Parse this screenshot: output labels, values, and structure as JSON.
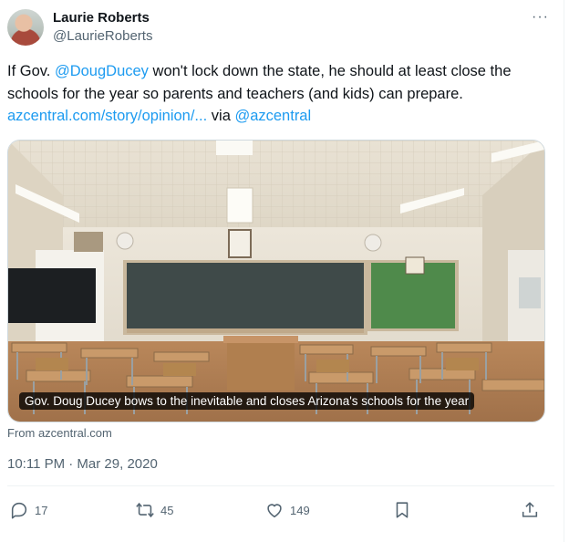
{
  "author": {
    "name": "Laurie Roberts",
    "handle": "@LaurieRoberts"
  },
  "tweet": {
    "part1": "If Gov. ",
    "mention1": "@DougDucey",
    "part2": " won't lock down the state, he should at least close the schools for the year so parents and teachers (and kids) can prepare.",
    "link": "azcentral.com/story/opinion/...",
    "via": " via ",
    "mention2": "@azcentral"
  },
  "card": {
    "caption": "Gov. Doug Ducey bows to the inevitable and closes Arizona's schools for the year",
    "source": "From azcentral.com"
  },
  "timestamp": "10:11 PM · Mar 29, 2020",
  "actions": {
    "replies": "17",
    "retweets": "45",
    "likes": "149"
  },
  "icons": [
    "more-dots-icon",
    "reply-icon",
    "retweet-icon",
    "like-icon",
    "bookmark-icon",
    "share-icon"
  ],
  "colors": {
    "link": "#1d9bf0",
    "muted": "#536471",
    "text": "#0f1419"
  }
}
